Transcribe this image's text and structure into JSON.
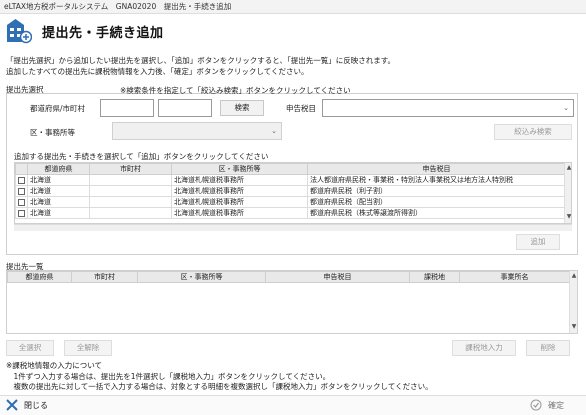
{
  "window": {
    "title": "eLTAX地方税ポータルシステム　GNA02020　提出先・手続き追加"
  },
  "page": {
    "title": "提出先・手続き追加"
  },
  "instructions": {
    "line1": "「提出先選択」から追加したい提出先を選択し、「追加」ボタンをクリックすると、「提出先一覧」に反映されます。",
    "line2": "追加したすべての提出先に課税物情報を入力後、「確定」ボタンをクリックしてください。"
  },
  "select_section": {
    "label": "提出先選択",
    "hint": "※検索条件を指定して「絞込み検索」ボタンをクリックしてください",
    "pref_label": "都道府県/市町村",
    "pref_value": "",
    "city_value": "",
    "search_button": "検索",
    "tax_label": "申告税目",
    "tax_value": "",
    "office_label": "区・事務所等",
    "office_value": "",
    "filter_button": "絞込み検索",
    "table_hint": "追加する提出先・手続きを選択して「追加」ボタンをクリックしてください",
    "columns": [
      "都道府県",
      "市町村",
      "区・事務所等",
      "申告税目"
    ],
    "rows": [
      {
        "pref": "北海道",
        "city": "",
        "office": "北海道札幌道税事務所",
        "tax": "法人都道府県民税・事業税・特別法人事業税又は地方法人特別税"
      },
      {
        "pref": "北海道",
        "city": "",
        "office": "北海道札幌道税事務所",
        "tax": "都道府県民税（利子割）"
      },
      {
        "pref": "北海道",
        "city": "",
        "office": "北海道札幌道税事務所",
        "tax": "都道府県民税（配当割）"
      },
      {
        "pref": "北海道",
        "city": "",
        "office": "北海道札幌道税事務所",
        "tax": "都道府県民税（株式等譲渡所得割）"
      }
    ],
    "add_button": "追加"
  },
  "list_section": {
    "label": "提出先一覧",
    "columns": [
      "都道府県",
      "市町村",
      "区・事務所等",
      "申告税目",
      "課税地",
      "事業所名"
    ],
    "rows": [],
    "select_all_button": "全選択",
    "deselect_all_button": "全解除",
    "tax_input_button": "課税地入力",
    "delete_button": "削除"
  },
  "notes": {
    "line1": "※課税地情報の入力について",
    "line2": "　1件ずつ入力する場合は、提出先を1件選択し「課税地入力」ボタンをクリックしてください。",
    "line3": "　複数の提出先に対して一括で入力する場合は、対象とする明細を複数選択し「課税地入力」ボタンをクリックしてください。"
  },
  "footer": {
    "close_label": "閉じる",
    "confirm_label": "確定"
  },
  "colors": {
    "accent": "#2f6fb3",
    "header_bg": "#e9e9e9",
    "border": "#cfcfcf"
  }
}
